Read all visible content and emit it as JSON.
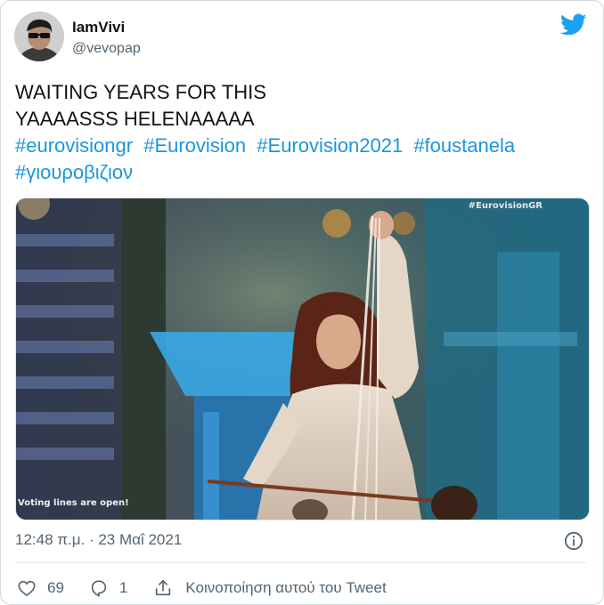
{
  "user": {
    "display_name": "IamVivi",
    "handle": "@vevopap"
  },
  "tweet": {
    "lines": [
      "WAITING YEARS FOR THIS",
      "YAAAASSS HELENAAAAA"
    ],
    "hashtags": [
      "#eurovisiongr",
      "#Eurovision",
      "#Eurovision2021",
      "#foustanela",
      "#γιουροβιζιον"
    ]
  },
  "media": {
    "watermark": "#EurovisionGR",
    "caption": "Voting lines are open!"
  },
  "meta": {
    "timestamp": "12:48 π.μ. · 23 Μαΐ 2021"
  },
  "actions": {
    "likes": "69",
    "replies": "1",
    "share_label": "Κοινοποίηση αυτού του Tweet"
  },
  "colors": {
    "accent": "#1da1f2",
    "link": "#1b95e0",
    "muted": "#536471",
    "like": "#e0245e"
  },
  "icons": [
    "twitter-bird-icon",
    "info-icon",
    "heart-icon",
    "reply-icon",
    "share-icon"
  ]
}
